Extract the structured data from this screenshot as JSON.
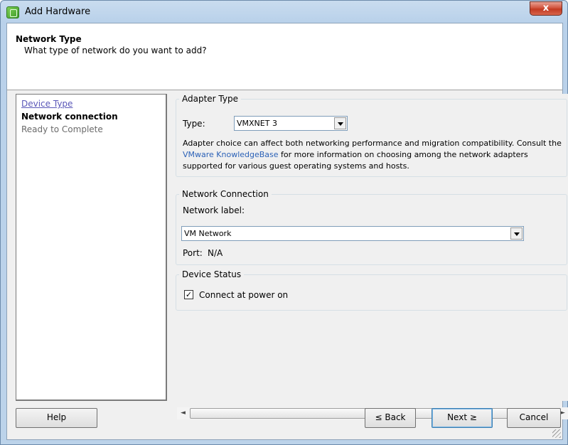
{
  "window": {
    "title": "Add Hardware",
    "close_label": "x"
  },
  "header": {
    "title": "Network Type",
    "subtitle": "What type of network do you want to add?"
  },
  "steps": [
    {
      "label": "Device Type",
      "state": "link"
    },
    {
      "label": "Network connection",
      "state": "current"
    },
    {
      "label": "Ready to Complete",
      "state": "disabled"
    }
  ],
  "adapter_type": {
    "legend": "Adapter Type",
    "type_label": "Type:",
    "type_value": "VMXNET 3",
    "desc_before": "Adapter choice can affect both networking performance and migration compatibility. Consult the ",
    "desc_link": "VMware KnowledgeBase",
    "desc_after": " for more information on choosing among the network adapters supported for various guest operating systems and hosts."
  },
  "network_connection": {
    "legend": "Network Connection",
    "network_label": "Network label:",
    "network_value": "VM Network",
    "port_label": "Port:",
    "port_value": "N/A"
  },
  "device_status": {
    "legend": "Device Status",
    "connect_label": "Connect at power on",
    "connect_checked": true,
    "check_mark": "✓"
  },
  "scrollbar": {
    "left_arrow": "◄",
    "right_arrow": "►",
    "thumb_grip": "III"
  },
  "buttons": {
    "help": "Help",
    "back": "≤ Back",
    "next": "Next ≥",
    "cancel": "Cancel"
  },
  "colors": {
    "link": "#2c62b7",
    "visited_step": "#5a57b8",
    "disabled_step": "#6b6b6b",
    "close_red": "#c23a22"
  }
}
